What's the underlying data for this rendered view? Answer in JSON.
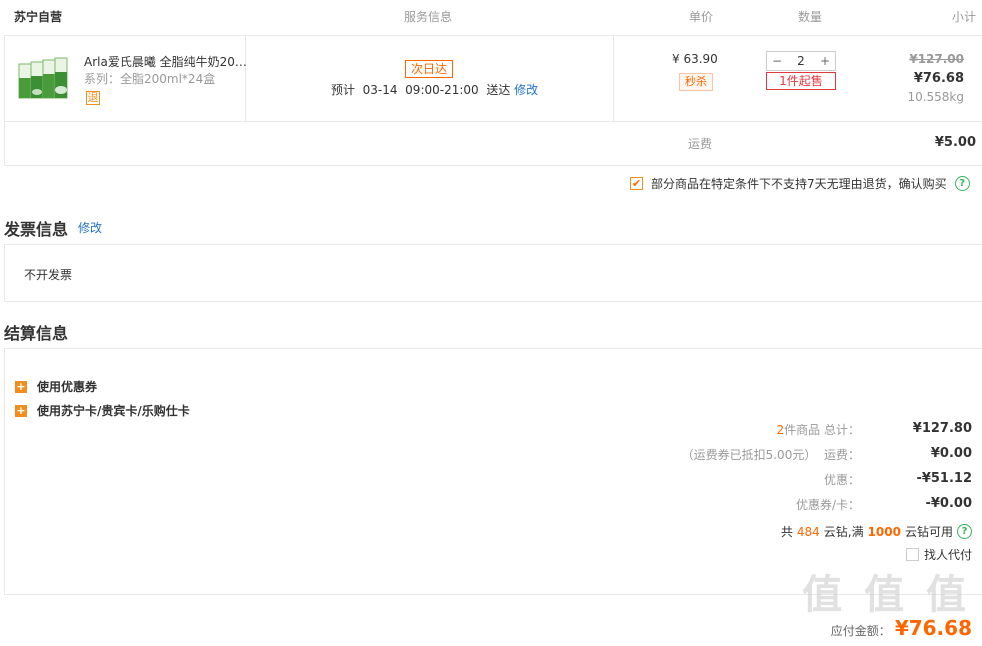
{
  "table_header": {
    "store": "苏宁自营",
    "service": "服务信息",
    "price": "单价",
    "qty": "数量",
    "subtotal": "小计"
  },
  "product": {
    "name": "Arla爱氏晨曦 全脂纯牛奶20…",
    "series": "系列：全脂200ml*24盒",
    "return_badge": "退",
    "delivery_tag": "次日达",
    "delivery_prefix": "预计",
    "delivery_date": "03-14",
    "delivery_time": "09:00-21:00",
    "delivery_suffix": "送达",
    "modify_link": "修改",
    "price": "¥ 63.90",
    "flash_sale": "秒杀",
    "qty_minus": "−",
    "qty_value": "2",
    "qty_plus": "+",
    "min_purchase": "1件起售",
    "original_total": "¥127.00",
    "total": "¥76.68",
    "weight": "10.558kg"
  },
  "shipping": {
    "label": "运费",
    "value": "¥5.00"
  },
  "return_notice": {
    "text": "部分商品在特定条件下不支持7天无理由退货，确认购买",
    "checked": true
  },
  "invoice": {
    "title": "发票信息",
    "modify": "修改",
    "value": "不开发票"
  },
  "settlement": {
    "title": "结算信息",
    "coupon": "使用优惠券",
    "card": "使用苏宁卡/贵宾卡/乐购仕卡",
    "items_count": "2",
    "items_label": "件商品 总计：",
    "items_total": "¥127.80",
    "shipping_note": "（运费券已抵扣5.00元）",
    "shipping_label": "运费：",
    "shipping_value": "¥0.00",
    "discount_label": "优惠：",
    "discount_value": "-¥51.12",
    "coupon_card_label": "优惠券/卡：",
    "coupon_card_value": "-¥0.00",
    "yunzuan_prefix": "共",
    "yunzuan_count": "484",
    "yunzuan_mid": "云钻,满",
    "yunzuan_min": "1000",
    "yunzuan_suffix": "云钻可用",
    "proxy_pay": "找人代付",
    "payable_label": "应付金额：",
    "payable_value": "¥76.68"
  },
  "watermark": "值 值 值",
  "colors": {
    "accent": "#ff6600",
    "link": "#2272c8",
    "red": "#e4393c",
    "green": "#36b35a"
  }
}
